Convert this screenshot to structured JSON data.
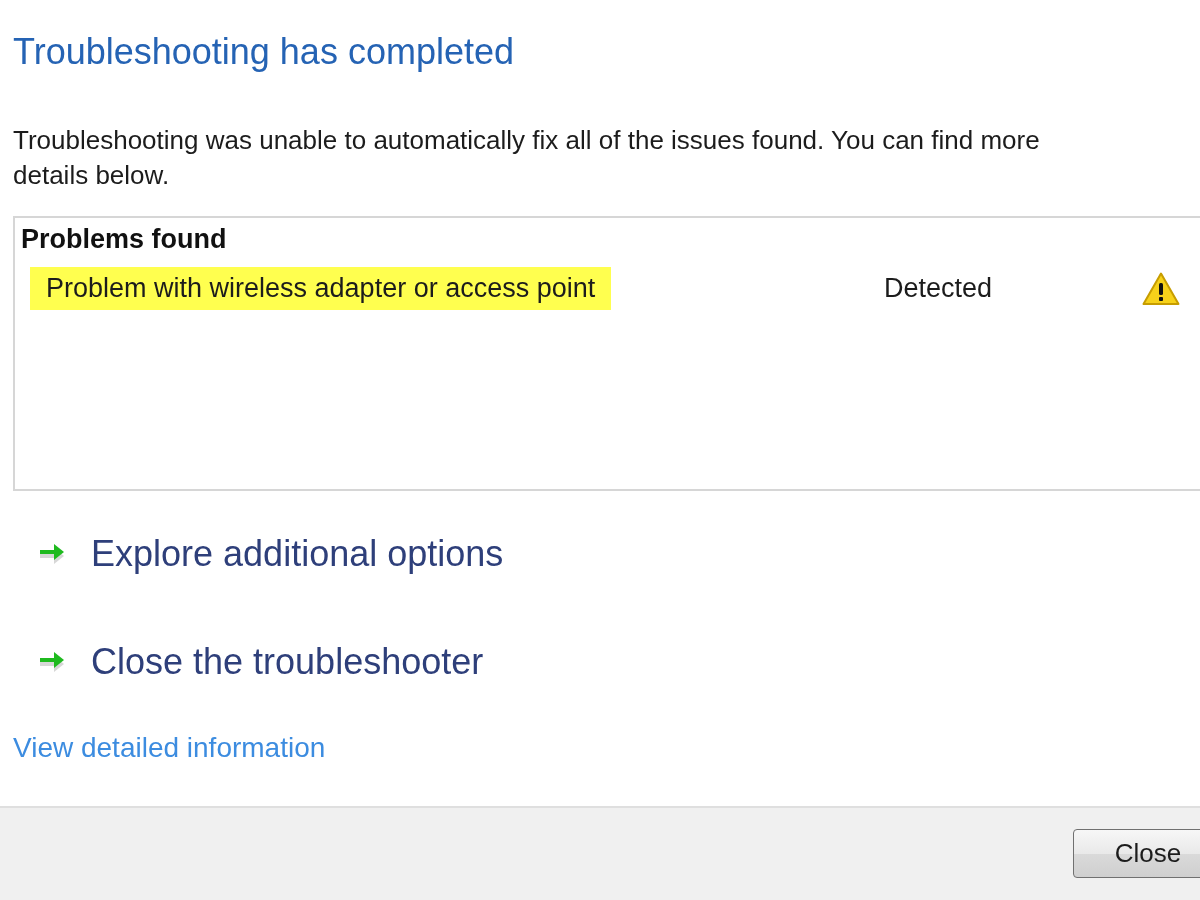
{
  "title": "Troubleshooting has completed",
  "description": "Troubleshooting was unable to automatically fix all of the issues found. You can find more details below.",
  "problems": {
    "heading": "Problems found",
    "rows": [
      {
        "name": "Problem with wireless adapter or access point",
        "highlighted": true,
        "status": "Detected",
        "kind": "warning"
      }
    ]
  },
  "options": [
    {
      "label": "Explore additional options"
    },
    {
      "label": "Close the troubleshooter"
    }
  ],
  "details_link": "View detailed information",
  "buttons": [
    {
      "label": "Close"
    }
  ]
}
